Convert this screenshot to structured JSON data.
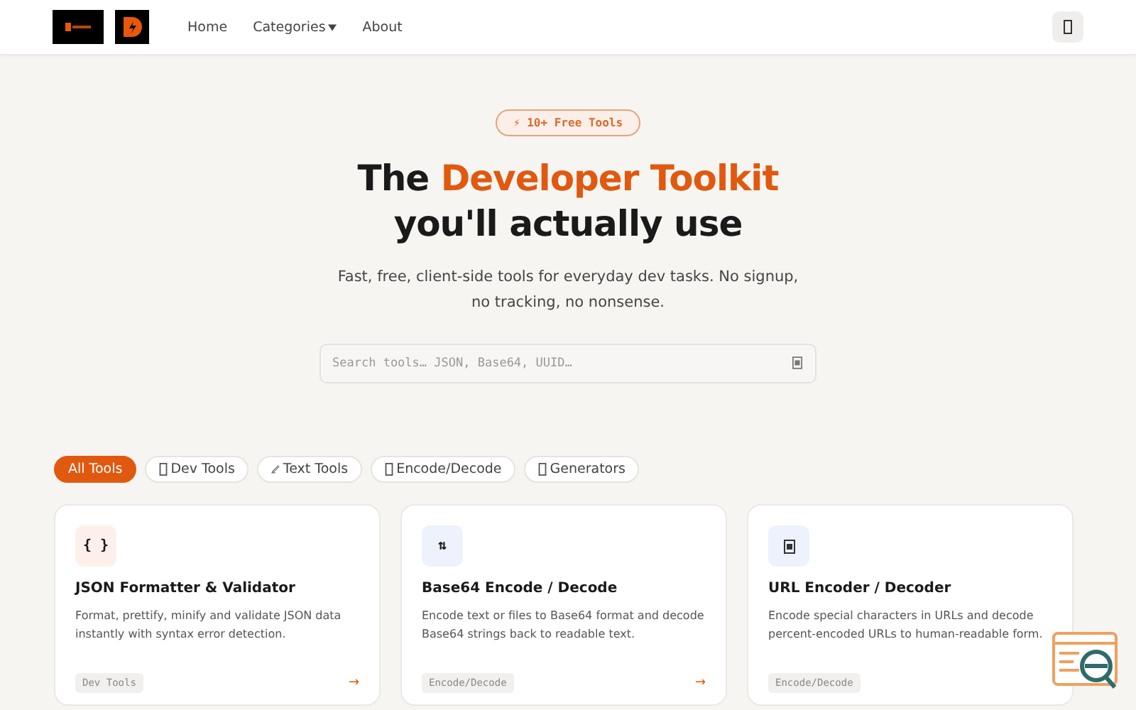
{
  "nav": {
    "links": [
      {
        "label": "Home",
        "dropdown": false
      },
      {
        "label": "Categories",
        "dropdown": true
      },
      {
        "label": "About",
        "dropdown": false
      }
    ]
  },
  "hero": {
    "badge": "⚡ 10+ Free Tools",
    "title_plain": "The",
    "title_accent": "Developer Toolkit",
    "title_line2": "you'll actually use",
    "subtitle": "Fast, free, client-side tools for everyday dev tasks. No signup, no tracking, no nonsense.",
    "search": {
      "placeholder": "Search tools… JSON, Base64, UUID…"
    }
  },
  "filters": [
    {
      "label": "All Tools",
      "kind": "plain",
      "selected": true
    },
    {
      "label": "Dev Tools",
      "kind": "boxed",
      "selected": false
    },
    {
      "label": "Text Tools",
      "kind": "pen",
      "selected": false
    },
    {
      "label": "Encode/Decode",
      "kind": "boxed",
      "selected": false
    },
    {
      "label": "Generators",
      "kind": "boxed",
      "selected": false
    }
  ],
  "cards": [
    {
      "kind": "glyph",
      "icon": "{ }",
      "color": "#fdf0ea",
      "title": "JSON Formatter & Validator",
      "description": "Format, prettify, minify and validate JSON data instantly with syntax error detection.",
      "tag": "Dev Tools",
      "arrow": "→"
    },
    {
      "kind": "glyph",
      "icon": "⇅",
      "color": "#edf2fd",
      "title": "Base64 Encode / Decode",
      "description": "Encode text or files to Base64 format and decode Base64 strings back to readable text.",
      "tag": "Encode/Decode",
      "arrow": "→"
    },
    {
      "kind": "box",
      "color": "#edf2fd",
      "title": "URL Encoder / Decoder",
      "description": "Encode special characters in URLs and decode percent-encoded URLs to human-readable form.",
      "tag": "Encode/Decode"
    }
  ]
}
